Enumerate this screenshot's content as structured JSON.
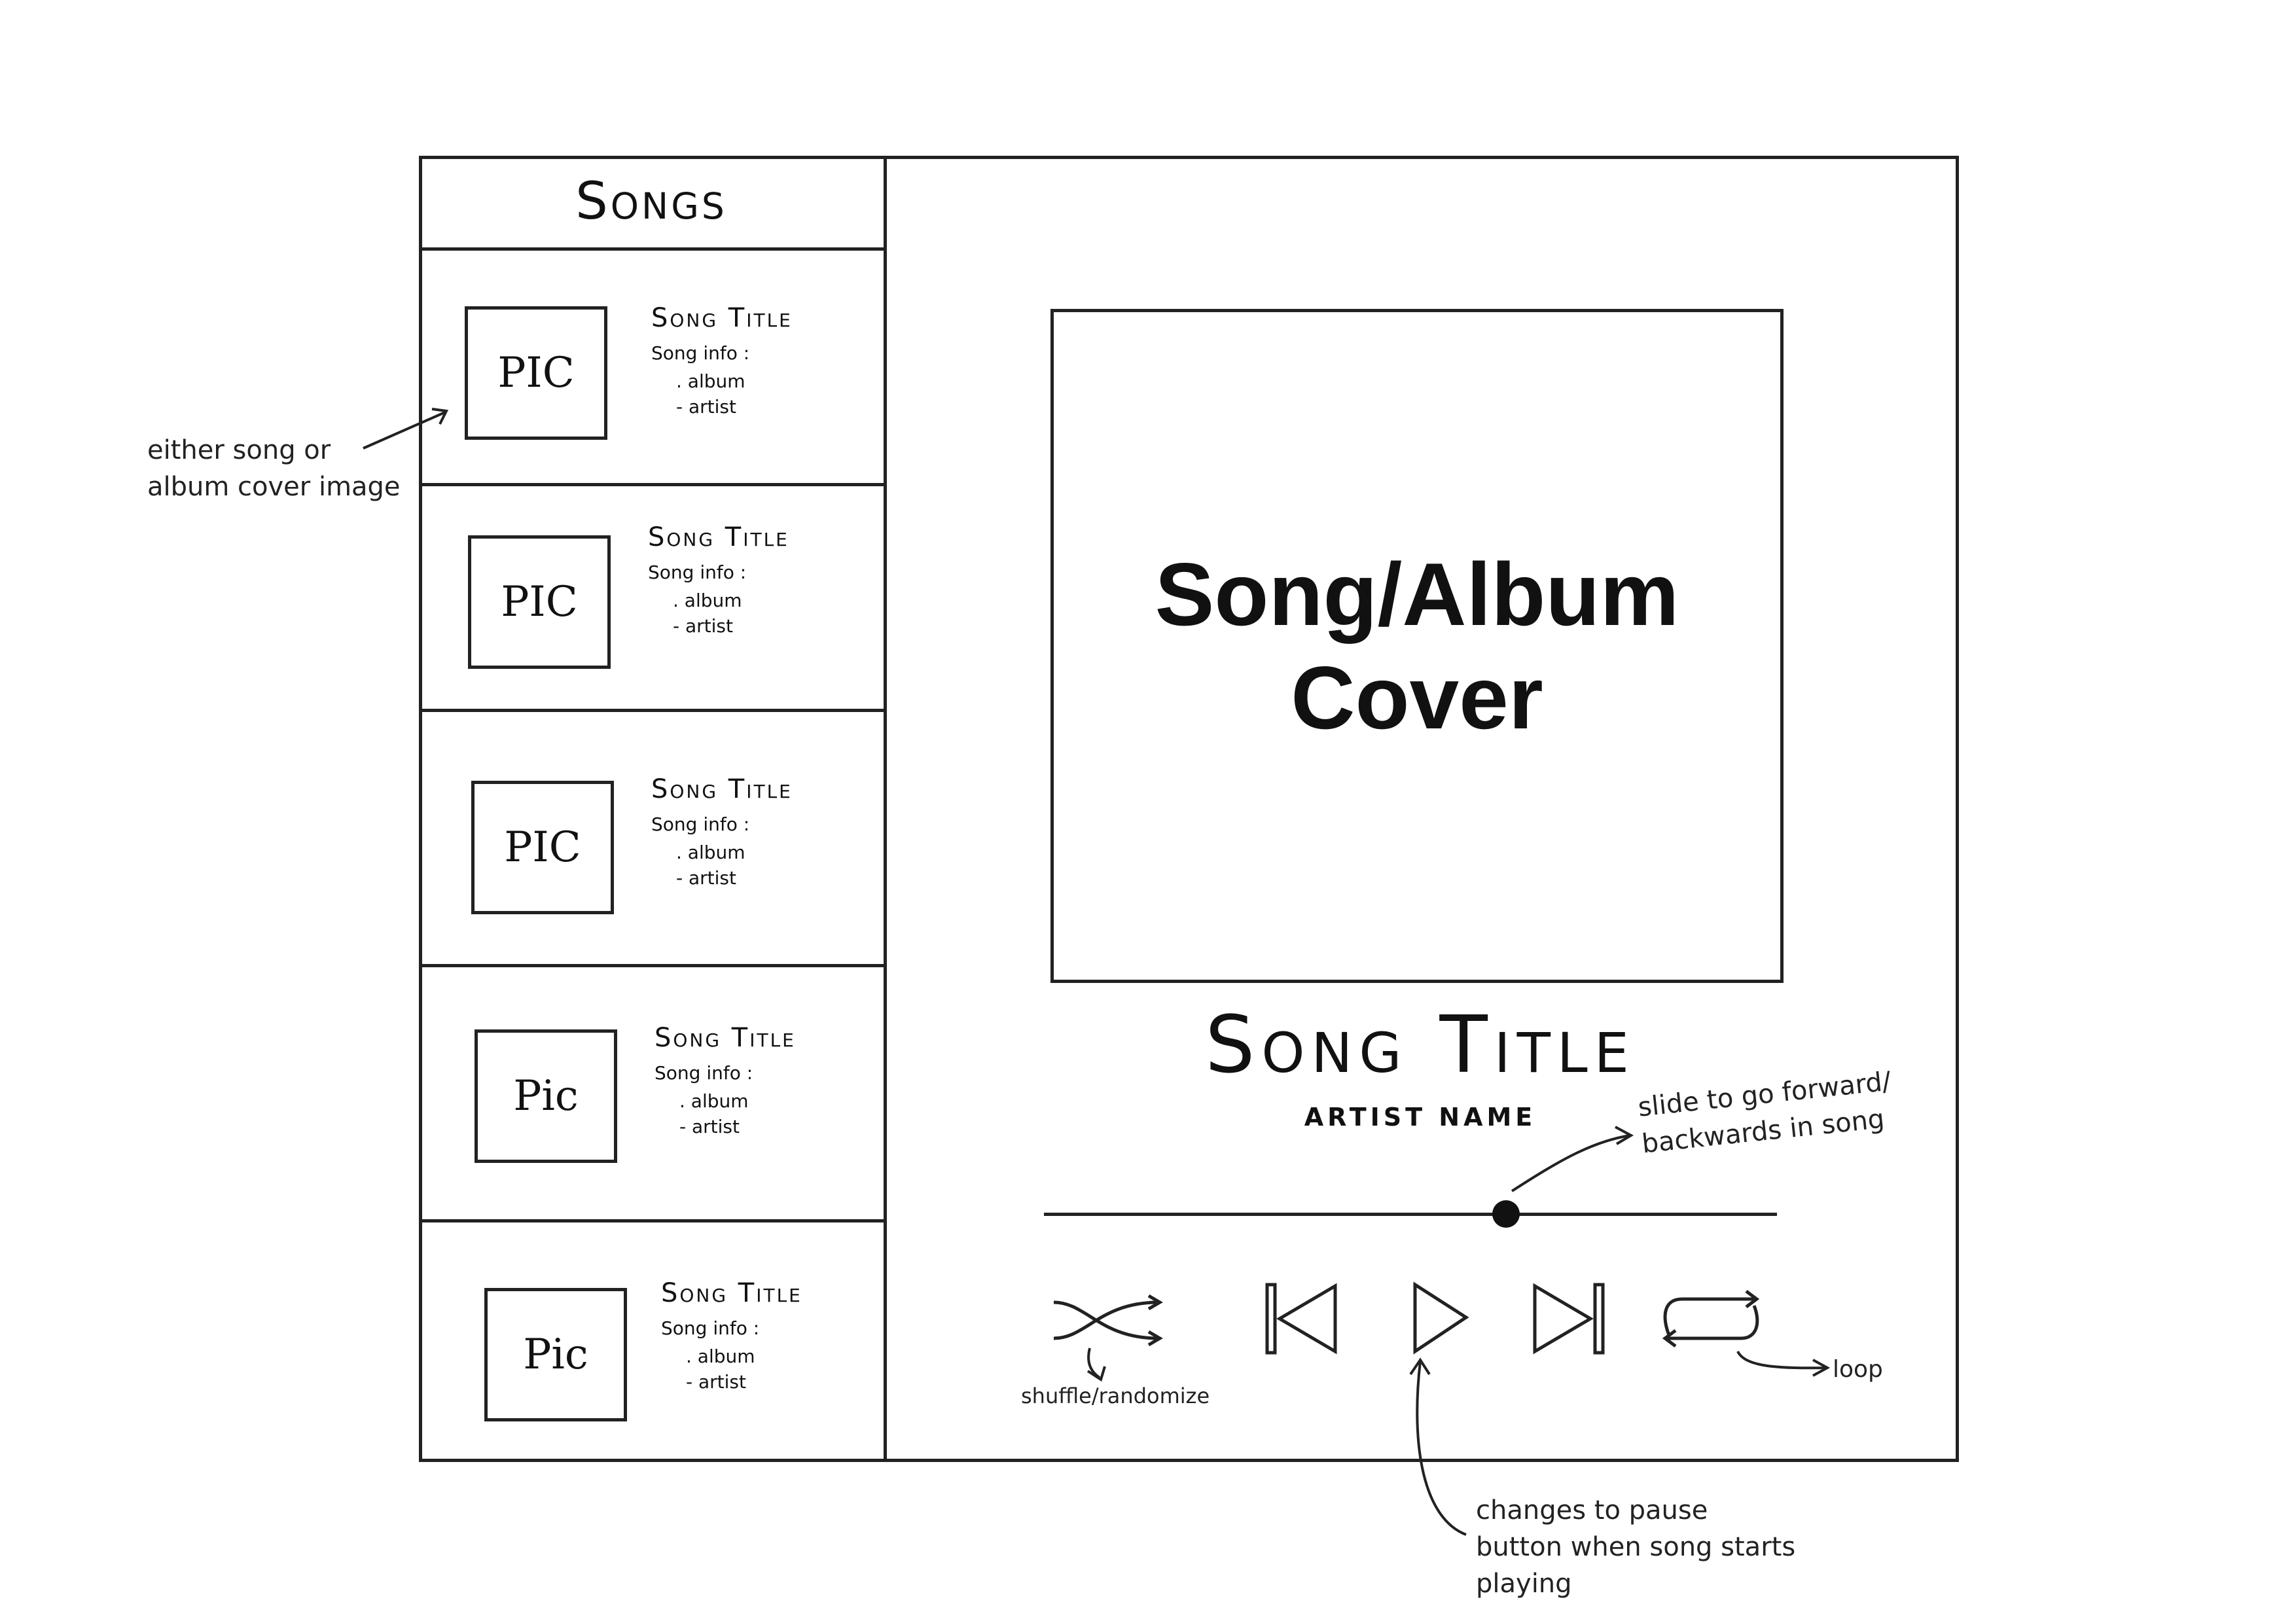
{
  "sidebar": {
    "title": "Songs",
    "items": [
      {
        "pic": "PIC",
        "title": "Song Title",
        "info_label": "Song info :",
        "album": ". album",
        "artist": "- artist"
      },
      {
        "pic": "PIC",
        "title": "Song Title",
        "info_label": "Song info :",
        "album": ". album",
        "artist": "- artist"
      },
      {
        "pic": "PIC",
        "title": "Song Title",
        "info_label": "Song info :",
        "album": ". album",
        "artist": "- artist"
      },
      {
        "pic": "Pic",
        "title": "Song Title",
        "info_label": "Song info :",
        "album": ". album",
        "artist": "- artist"
      },
      {
        "pic": "Pic",
        "title": "Song Title",
        "info_label": "Song info :",
        "album": ". album",
        "artist": "- artist"
      }
    ]
  },
  "player": {
    "cover_text": "Song/Album\nCover",
    "song_title": "Song Title",
    "artist_name": "ARTIST NAME",
    "progress_fraction": 0.63,
    "controls": [
      "shuffle-icon",
      "skip-previous-icon",
      "play-icon",
      "skip-next-icon",
      "loop-icon"
    ]
  },
  "annotations": {
    "pic_note": "either song or\nalbum cover image",
    "slider_note": "slide to go forward/\nbackwards in song",
    "shuffle_note": "shuffle/randomize",
    "loop_note": "loop",
    "play_note": "changes to pause\nbutton when song starts\nplaying"
  }
}
